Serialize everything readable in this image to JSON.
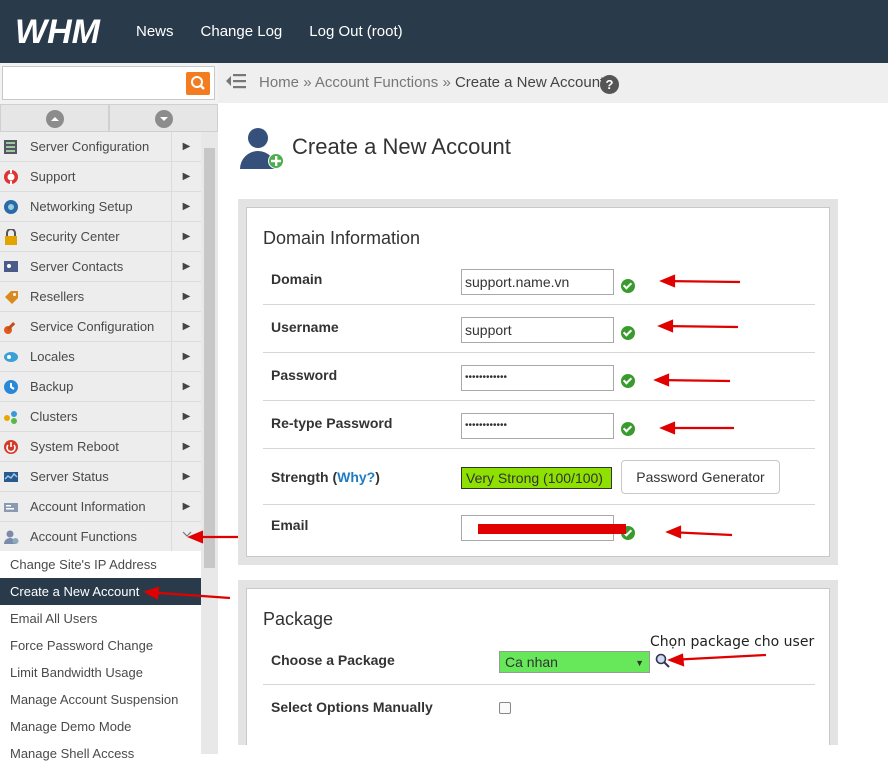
{
  "header": {
    "logo": "WHM",
    "nav": [
      "News",
      "Change Log",
      "Log Out (root)"
    ]
  },
  "sidebar": {
    "search_value": "",
    "items": [
      {
        "label": "Server Configuration",
        "icon": "server-config-icon"
      },
      {
        "label": "Support",
        "icon": "lifebuoy-icon"
      },
      {
        "label": "Networking Setup",
        "icon": "network-icon"
      },
      {
        "label": "Security Center",
        "icon": "lock-icon"
      },
      {
        "label": "Server Contacts",
        "icon": "contacts-icon"
      },
      {
        "label": "Resellers",
        "icon": "resellers-icon"
      },
      {
        "label": "Service Configuration",
        "icon": "wrench-icon"
      },
      {
        "label": "Locales",
        "icon": "locales-icon"
      },
      {
        "label": "Backup",
        "icon": "backup-icon"
      },
      {
        "label": "Clusters",
        "icon": "clusters-icon"
      },
      {
        "label": "System Reboot",
        "icon": "power-icon"
      },
      {
        "label": "Server Status",
        "icon": "status-icon"
      },
      {
        "label": "Account Information",
        "icon": "account-info-icon"
      },
      {
        "label": "Account Functions",
        "icon": "account-functions-icon"
      }
    ],
    "subitems": [
      "Change Site's IP Address",
      "Create a New Account",
      "Email All Users",
      "Force Password Change",
      "Limit Bandwidth Usage",
      "Manage Account Suspension",
      "Manage Demo Mode",
      "Manage Shell Access"
    ],
    "active_subitem": "Create a New Account"
  },
  "breadcrumb": {
    "home": "Home",
    "sep": "»",
    "section": "Account Functions",
    "current": "Create a New Account",
    "help": "?"
  },
  "page": {
    "title": "Create a New Account"
  },
  "domain_info": {
    "title": "Domain Information",
    "domain_label": "Domain",
    "domain_value": "support.name.vn",
    "username_label": "Username",
    "username_value": "support",
    "password_label": "Password",
    "password_value": "••••••••••••",
    "retype_label": "Re-type Password",
    "retype_value": "••••••••••••",
    "strength_label": "Strength",
    "why_label": "Why?",
    "strength_value": "Very Strong (100/100)",
    "password_generator": "Password Generator",
    "email_label": "Email",
    "email_value": ""
  },
  "package": {
    "title": "Package",
    "choose_label": "Choose a Package",
    "selected": "Ca nhan",
    "manual_label": "Select Options Manually",
    "manual_checked": false
  },
  "annotation": {
    "note": "Chọn package cho user",
    "arrow_color": "#e00000"
  },
  "colors": {
    "header_bg": "#293a4a",
    "accent_orange": "#f47c20",
    "valid_green": "#3a9a2e",
    "strength_bg": "#8ee000",
    "package_bg": "#66e85a",
    "link_blue": "#1f7cc4"
  }
}
